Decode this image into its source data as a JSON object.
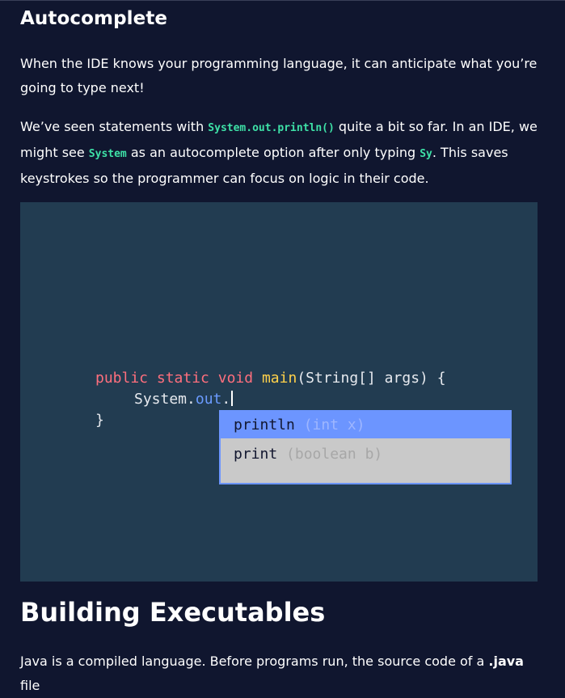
{
  "section": {
    "heading": "Autocomplete",
    "para1": "When the IDE knows your programming language, it can anticipate what you’re going to type next!",
    "para2": {
      "t1": "We’ve seen statements with ",
      "code1": "System.out.println()",
      "t2": " quite a bit so far. In an IDE, we might see ",
      "code2": "System",
      "t3": " as an autocomplete option after only typing ",
      "code3": "Sy",
      "t4": ". This saves keystrokes so the programmer can focus on logic in their code."
    }
  },
  "illustration": {
    "line1": {
      "kw1": "public",
      "kw2": "static",
      "kw3": "void",
      "fn": "main",
      "rest": "(String[] args) {"
    },
    "line2": {
      "obj": "System.",
      "prop": "out",
      "dot": "."
    },
    "line3": "}",
    "suggestions": [
      {
        "name": "println",
        "args": "(int x)"
      },
      {
        "name": "print",
        "args": "(boolean b)"
      }
    ]
  },
  "next_section": {
    "heading": "Building Executables",
    "para": {
      "t1": "Java is a compiled language. Before programs run, the source code of a ",
      "bold": ".java",
      "t2": " file"
    }
  },
  "colors": {
    "background": "#10162f",
    "inline_code": "#3ee1a7",
    "illustration_bg": "#223c51",
    "keyword": "#ff6f7d",
    "function": "#ffd14a",
    "property": "#6b9bff",
    "popup_selected": "#6c95ff",
    "popup_bg": "#c9c9c9"
  }
}
